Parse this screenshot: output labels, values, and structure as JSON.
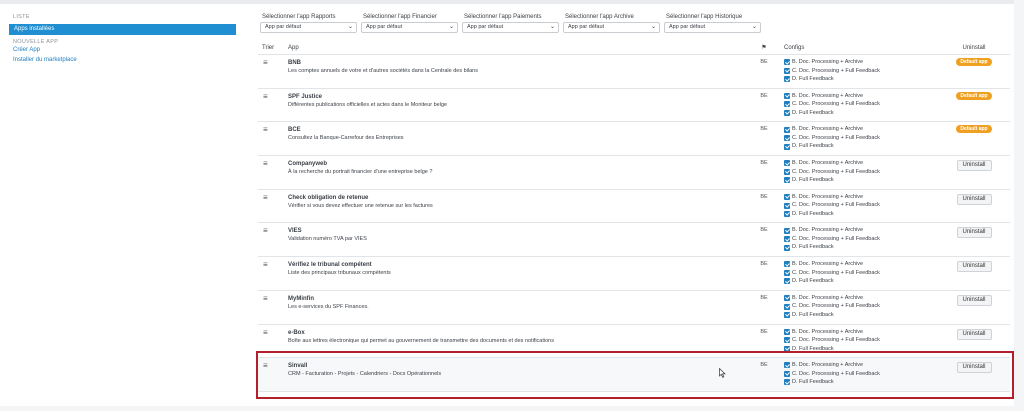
{
  "sidebar": {
    "section1": "LISTE",
    "active_item": "Apps installées",
    "section2": "NOUVELLE APP",
    "links": [
      "Créer App",
      "Installer du marketplace"
    ]
  },
  "selectors": [
    {
      "label": "Sélectionner l'app Rapports",
      "value": "App par défaut"
    },
    {
      "label": "Sélectionner l'app Financier",
      "value": "App par défaut"
    },
    {
      "label": "Sélectionner l'app Paiements",
      "value": "App par défaut"
    },
    {
      "label": "Sélectionner l'app Archive",
      "value": "App par défaut"
    },
    {
      "label": "Sélectionner l'app Historique",
      "value": "App par défaut"
    }
  ],
  "table": {
    "headers": {
      "trier": "Trier",
      "app": "App",
      "flag": "⚑",
      "configs": "Configs",
      "uninstall": "Uninstall"
    },
    "configs": [
      "B. Doc. Processing + Archive",
      "C. Doc. Processing + Full Feedback",
      "D. Full Feedback"
    ],
    "rows": [
      {
        "name": "BNB",
        "desc": "Les comptes annuels de votre et d'autres sociétés dans la Centrale des bilans",
        "flag": "BE",
        "action": "Default app",
        "action_type": "badge"
      },
      {
        "name": "SPF Justice",
        "desc": "Différentes publications officielles et actes dans le Moniteur belge",
        "flag": "BE",
        "action": "Default app",
        "action_type": "badge"
      },
      {
        "name": "BCE",
        "desc": "Consultez la Banque-Carrefour des Entreprises",
        "flag": "BE",
        "action": "Default app",
        "action_type": "badge"
      },
      {
        "name": "Companyweb",
        "desc": "À la recherche du portrait financier d'une entreprise belge ?",
        "flag": "BE",
        "action": "Uninstall",
        "action_type": "button"
      },
      {
        "name": "Check obligation de retenue",
        "desc": "Vérifier si vous devez effectuer une retenue sur les factures",
        "flag": "BE",
        "action": "Uninstall",
        "action_type": "button"
      },
      {
        "name": "VIES",
        "desc": "Validation numéro TVA par VIES",
        "flag": "BE",
        "action": "Uninstall",
        "action_type": "button"
      },
      {
        "name": "Vérifiez le tribunal compétent",
        "desc": "Liste des principaux tribunaux compétents",
        "flag": "BE",
        "action": "Uninstall",
        "action_type": "button"
      },
      {
        "name": "MyMinfin",
        "desc": "Les e-services du SPF Finances.",
        "flag": "BE",
        "action": "Uninstall",
        "action_type": "button"
      },
      {
        "name": "e-Box",
        "desc": "Boîte aux lettres électronique qui permet au gouvernement de transmettre des documents et des notifications",
        "flag": "BE",
        "action": "Uninstall",
        "action_type": "button"
      },
      {
        "name": "Sinvall",
        "desc": "CRM - Facturation - Projets - Calendriers - Docs Opérationnels",
        "flag": "BE",
        "action": "Uninstall",
        "action_type": "button"
      }
    ]
  },
  "colors": {
    "accent": "#1f8fd2",
    "badge": "#f0a020",
    "highlight_border": "#b3202c"
  }
}
